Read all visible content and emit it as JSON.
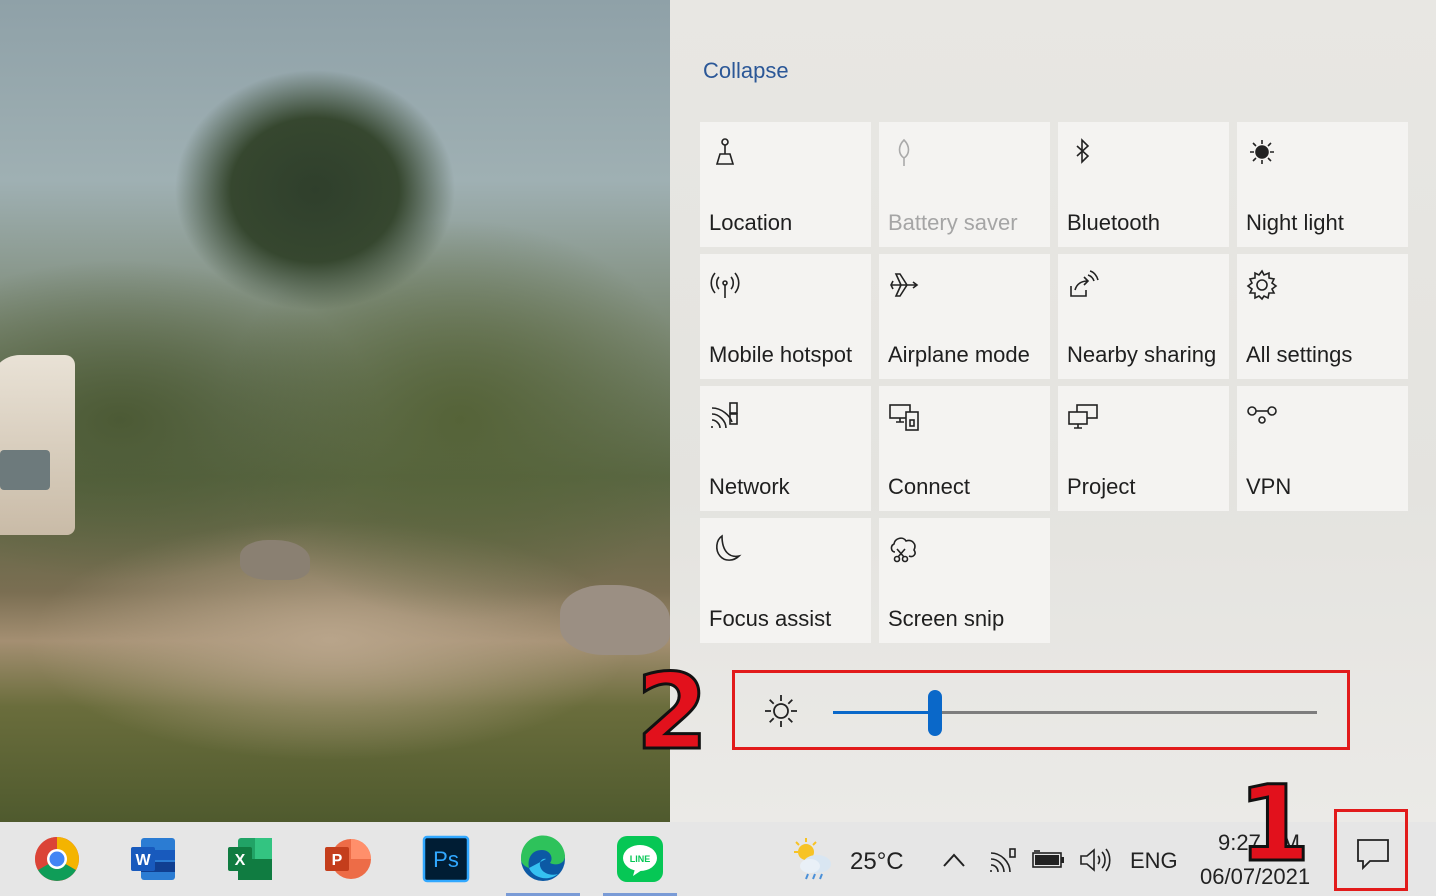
{
  "action_center": {
    "collapse_label": "Collapse",
    "tiles": [
      {
        "label": "Location",
        "icon": "location-icon",
        "enabled": true
      },
      {
        "label": "Battery saver",
        "icon": "battery-saver-icon",
        "enabled": false
      },
      {
        "label": "Bluetooth",
        "icon": "bluetooth-icon",
        "enabled": true
      },
      {
        "label": "Night light",
        "icon": "night-light-icon",
        "enabled": true
      },
      {
        "label": "Mobile hotspot",
        "icon": "mobile-hotspot-icon",
        "enabled": true
      },
      {
        "label": "Airplane mode",
        "icon": "airplane-icon",
        "enabled": true
      },
      {
        "label": "Nearby sharing",
        "icon": "nearby-sharing-icon",
        "enabled": true
      },
      {
        "label": "All settings",
        "icon": "gear-icon",
        "enabled": true
      },
      {
        "label": "Network",
        "icon": "network-icon",
        "enabled": true
      },
      {
        "label": "Connect",
        "icon": "connect-icon",
        "enabled": true
      },
      {
        "label": "Project",
        "icon": "project-icon",
        "enabled": true
      },
      {
        "label": "VPN",
        "icon": "vpn-icon",
        "enabled": true
      },
      {
        "label": "Focus assist",
        "icon": "moon-icon",
        "enabled": true
      },
      {
        "label": "Screen snip",
        "icon": "screen-snip-icon",
        "enabled": true
      }
    ],
    "brightness": {
      "icon": "brightness-icon",
      "level_fraction": 0.21
    }
  },
  "annotations": {
    "step1": "1",
    "step2": "2"
  },
  "taskbar": {
    "apps": [
      {
        "name": "chrome",
        "icon": "chrome-icon",
        "letter": ""
      },
      {
        "name": "word",
        "icon": "word-icon",
        "letter": "W"
      },
      {
        "name": "excel",
        "icon": "excel-icon",
        "letter": "X"
      },
      {
        "name": "powerpoint",
        "icon": "powerpoint-icon",
        "letter": "P"
      },
      {
        "name": "photoshop",
        "icon": "photoshop-icon",
        "letter": "Ps"
      },
      {
        "name": "edge",
        "icon": "edge-icon",
        "letter": ""
      },
      {
        "name": "line",
        "icon": "line-icon",
        "letter": "LINE"
      }
    ],
    "weather": {
      "icon": "weather-cloud-sun-icon",
      "temperature": "25°C"
    },
    "tray_icons": [
      "chevron-up-icon",
      "wifi-icon",
      "battery-icon",
      "volume-icon"
    ],
    "language": "ENG",
    "time": "9:27 PM",
    "date": "06/07/2021",
    "notification_icon": "notification-icon"
  },
  "colors": {
    "accent": "#0a68c9",
    "annotation_red": "#e21b1b",
    "link": "#2b5797"
  }
}
